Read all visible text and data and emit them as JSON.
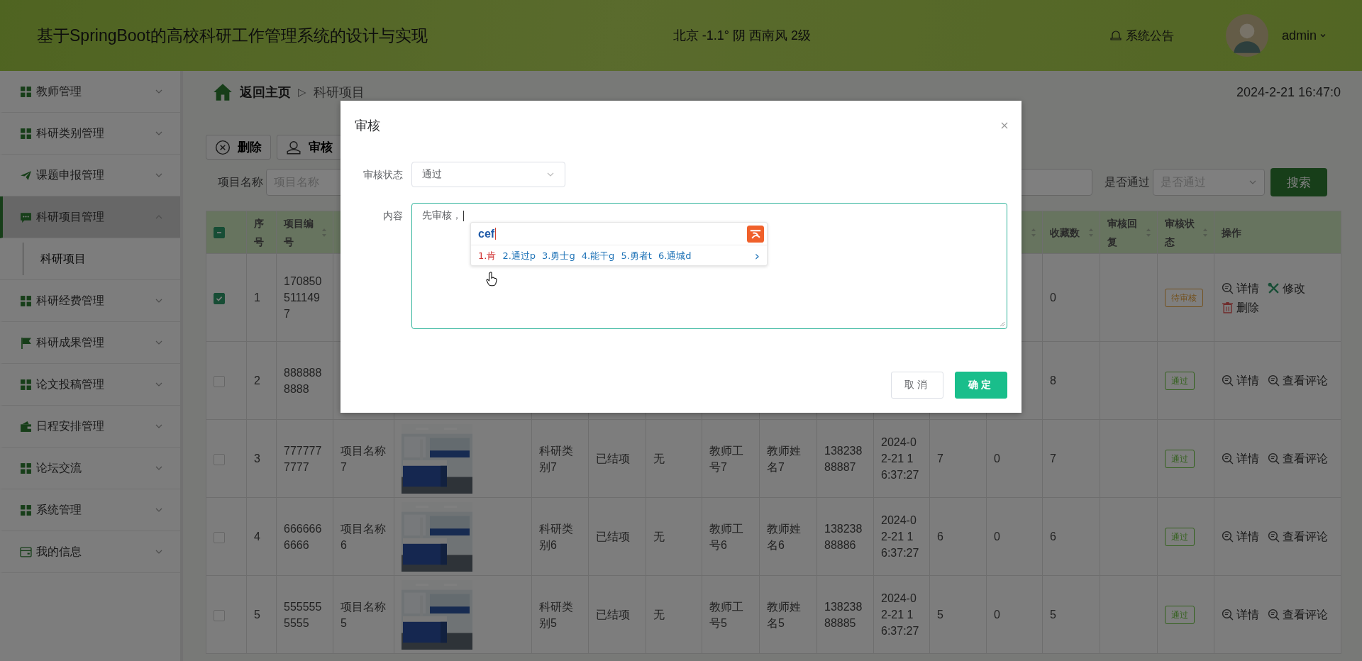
{
  "header": {
    "title": "基于SpringBoot的高校科研工作管理系统的设计与实现",
    "weather": "北京 -1.1° 阴 西南风 2级",
    "notice": "系统公告",
    "user": "admin"
  },
  "sidebar": {
    "items": [
      {
        "label": "教师管理",
        "kind": "grid",
        "expanded": false,
        "selected": false
      },
      {
        "label": "科研类别管理",
        "kind": "grid",
        "expanded": false,
        "selected": false
      },
      {
        "label": "课题申报管理",
        "kind": "plane",
        "expanded": false,
        "selected": false
      },
      {
        "label": "科研项目管理",
        "kind": "chat",
        "expanded": true,
        "selected": true,
        "children": [
          {
            "label": "科研项目",
            "selected": true
          }
        ]
      },
      {
        "label": "科研经费管理",
        "kind": "grid",
        "expanded": false,
        "selected": false
      },
      {
        "label": "科研成果管理",
        "kind": "flag",
        "expanded": false,
        "selected": false
      },
      {
        "label": "论文投稿管理",
        "kind": "grid",
        "expanded": false,
        "selected": false
      },
      {
        "label": "日程安排管理",
        "kind": "wallet",
        "expanded": false,
        "selected": false
      },
      {
        "label": "论坛交流",
        "kind": "grid",
        "expanded": false,
        "selected": false
      },
      {
        "label": "系统管理",
        "kind": "grid",
        "expanded": false,
        "selected": false
      },
      {
        "label": "我的信息",
        "kind": "card",
        "expanded": false,
        "selected": false
      }
    ]
  },
  "breadcrumb": {
    "home": "返回主页",
    "separator": "▷",
    "current": "科研项目"
  },
  "datetime": "2024-2-21 16:47:0",
  "toolbar": [
    {
      "label": "删除",
      "kind": "delete"
    },
    {
      "label": "审核",
      "kind": "review"
    }
  ],
  "search": {
    "fields": [
      {
        "kind": "input",
        "label": "项目名称",
        "placeholder": "项目名称"
      },
      {
        "kind": "input"
      },
      {
        "kind": "select",
        "label": "是否通过",
        "placeholder": "是否通过"
      }
    ],
    "button": "搜索"
  },
  "table": {
    "indeterminate": true,
    "columns": [
      {
        "label": "序号"
      },
      {
        "label": "项目编号",
        "sortable": true
      },
      {},
      {},
      {},
      {},
      {},
      {},
      {},
      {},
      {},
      {},
      {
        "sortable": true
      },
      {
        "label": "收藏数",
        "sortable": true
      },
      {
        "label": "审核回复",
        "sortable": true
      },
      {
        "label": "审核状态",
        "sortable": true
      },
      {
        "label": "操作"
      }
    ],
    "rows": [
      {
        "checked": true,
        "cells": [
          {
            "text": "1"
          },
          {
            "text": "1708505111497"
          },
          {},
          {},
          {},
          {},
          {},
          {},
          {},
          {},
          {},
          {},
          {},
          {
            "text": "0"
          },
          {},
          {
            "kind": "tag-warning",
            "text": "待审核"
          }
        ],
        "actions": [
          {
            "kind": "detail",
            "label": "详情"
          },
          {
            "kind": "tools",
            "label": "修改"
          },
          {
            "kind": "trash",
            "label": "删除"
          }
        ]
      },
      {
        "checked": false,
        "cells": [
          {
            "text": "2"
          },
          {
            "text": "8888888888"
          },
          {},
          {},
          {},
          {},
          {},
          {},
          {},
          {},
          {},
          {},
          {},
          {
            "text": "8"
          },
          {},
          {
            "kind": "tag-success",
            "text": "通过"
          }
        ],
        "actions": [
          {
            "kind": "detail",
            "label": "详情"
          },
          {
            "kind": "detail",
            "label": "查看评论"
          }
        ]
      },
      {
        "checked": false,
        "cells": [
          {
            "text": "3"
          },
          {
            "text": "7777777777"
          },
          {
            "text": "项目名称7"
          },
          {
            "kind": "picture"
          },
          {
            "text": "科研类别7"
          },
          {
            "text": "已结项"
          },
          {
            "text": "无"
          },
          {
            "text": "教师工号7"
          },
          {
            "text": "教师姓名7"
          },
          {
            "text": "13823888887"
          },
          {
            "text": "2024-02-21 16:37:27"
          },
          {
            "text": "7"
          },
          {
            "text": "0"
          },
          {
            "text": "7"
          },
          {},
          {
            "kind": "tag-success",
            "text": "通过"
          }
        ],
        "actions": [
          {
            "kind": "detail",
            "label": "详情"
          },
          {
            "kind": "detail",
            "label": "查看评论"
          }
        ]
      },
      {
        "checked": false,
        "cells": [
          {
            "text": "4"
          },
          {
            "text": "6666666666"
          },
          {
            "text": "项目名称6"
          },
          {
            "kind": "picture"
          },
          {
            "text": "科研类别6"
          },
          {
            "text": "已结项"
          },
          {
            "text": "无"
          },
          {
            "text": "教师工号6"
          },
          {
            "text": "教师姓名6"
          },
          {
            "text": "13823888886"
          },
          {
            "text": "2024-02-21 16:37:27"
          },
          {
            "text": "6"
          },
          {
            "text": "0"
          },
          {
            "text": "6"
          },
          {},
          {
            "kind": "tag-success",
            "text": "通过"
          }
        ],
        "actions": [
          {
            "kind": "detail",
            "label": "详情"
          },
          {
            "kind": "detail",
            "label": "查看评论"
          }
        ]
      },
      {
        "checked": false,
        "cells": [
          {
            "text": "5"
          },
          {
            "text": "5555555555"
          },
          {
            "text": "项目名称5"
          },
          {
            "kind": "picture"
          },
          {
            "text": "科研类别5"
          },
          {
            "text": "已结项"
          },
          {
            "text": "无"
          },
          {
            "text": "教师工号5"
          },
          {
            "text": "教师姓名5"
          },
          {
            "text": "13823888885"
          },
          {
            "text": "2024-02-21 16:37:27"
          },
          {
            "text": "5"
          },
          {
            "text": "0"
          },
          {
            "text": "5"
          },
          {},
          {
            "kind": "tag-success",
            "text": "通过"
          }
        ],
        "actions": [
          {
            "kind": "detail",
            "label": "详情"
          },
          {
            "kind": "detail",
            "label": "查看评论"
          }
        ]
      }
    ]
  },
  "dialog": {
    "title": "审核",
    "fields": [
      {
        "kind": "select",
        "label": "审核状态",
        "value": "通过"
      },
      {
        "kind": "textarea",
        "label": "内容",
        "value": "先审核，",
        "focused": true
      }
    ],
    "ime": {
      "composition": "cef",
      "candidates": [
        {
          "text": "1.肯",
          "selected": true
        },
        {
          "text": "2.通过p",
          "selected": false
        },
        {
          "text": "3.勇士g",
          "selected": false
        },
        {
          "text": "4.能干g",
          "selected": false
        },
        {
          "text": "5.勇者t",
          "selected": false
        },
        {
          "text": "6.通城d",
          "selected": false
        }
      ],
      "next": "›"
    },
    "buttons": [
      {
        "label": "取消",
        "kind": "default"
      },
      {
        "label": "确定",
        "kind": "primary"
      }
    ]
  }
}
